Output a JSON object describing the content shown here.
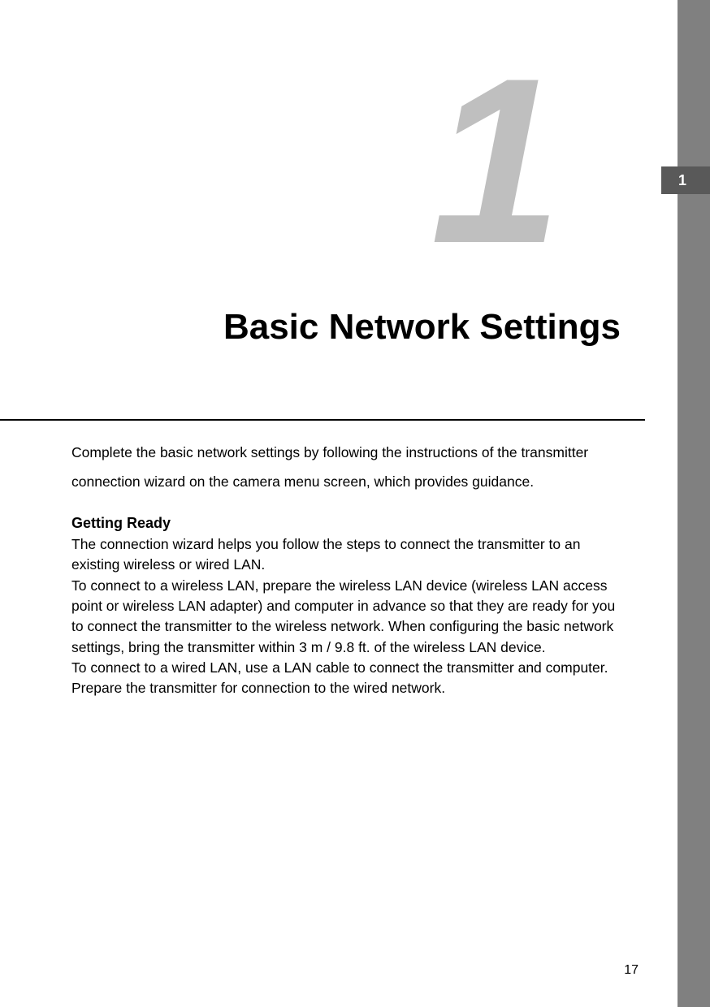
{
  "side_tab": "1",
  "chapter_number": "1",
  "chapter_title": "Basic Network Settings",
  "intro_paragraph": "Complete the basic network settings by following the instructions of the transmitter connection wizard on the camera menu screen, which provides guidance.",
  "section_heading": "Getting Ready",
  "body_p1": "The connection wizard helps you follow the steps to connect the transmitter to an existing wireless or wired LAN.",
  "body_p2": "To connect to a wireless LAN, prepare the wireless LAN device (wireless LAN access point or wireless LAN adapter) and computer in advance so that they are ready for you to connect the transmitter to the wireless network. When configuring the basic network settings, bring the transmitter within 3 m / 9.8 ft. of the wireless LAN device.",
  "body_p3": "To connect to a wired LAN, use a LAN cable to connect the transmitter and computer. Prepare the transmitter for connection to the wired network.",
  "page_number": "17"
}
